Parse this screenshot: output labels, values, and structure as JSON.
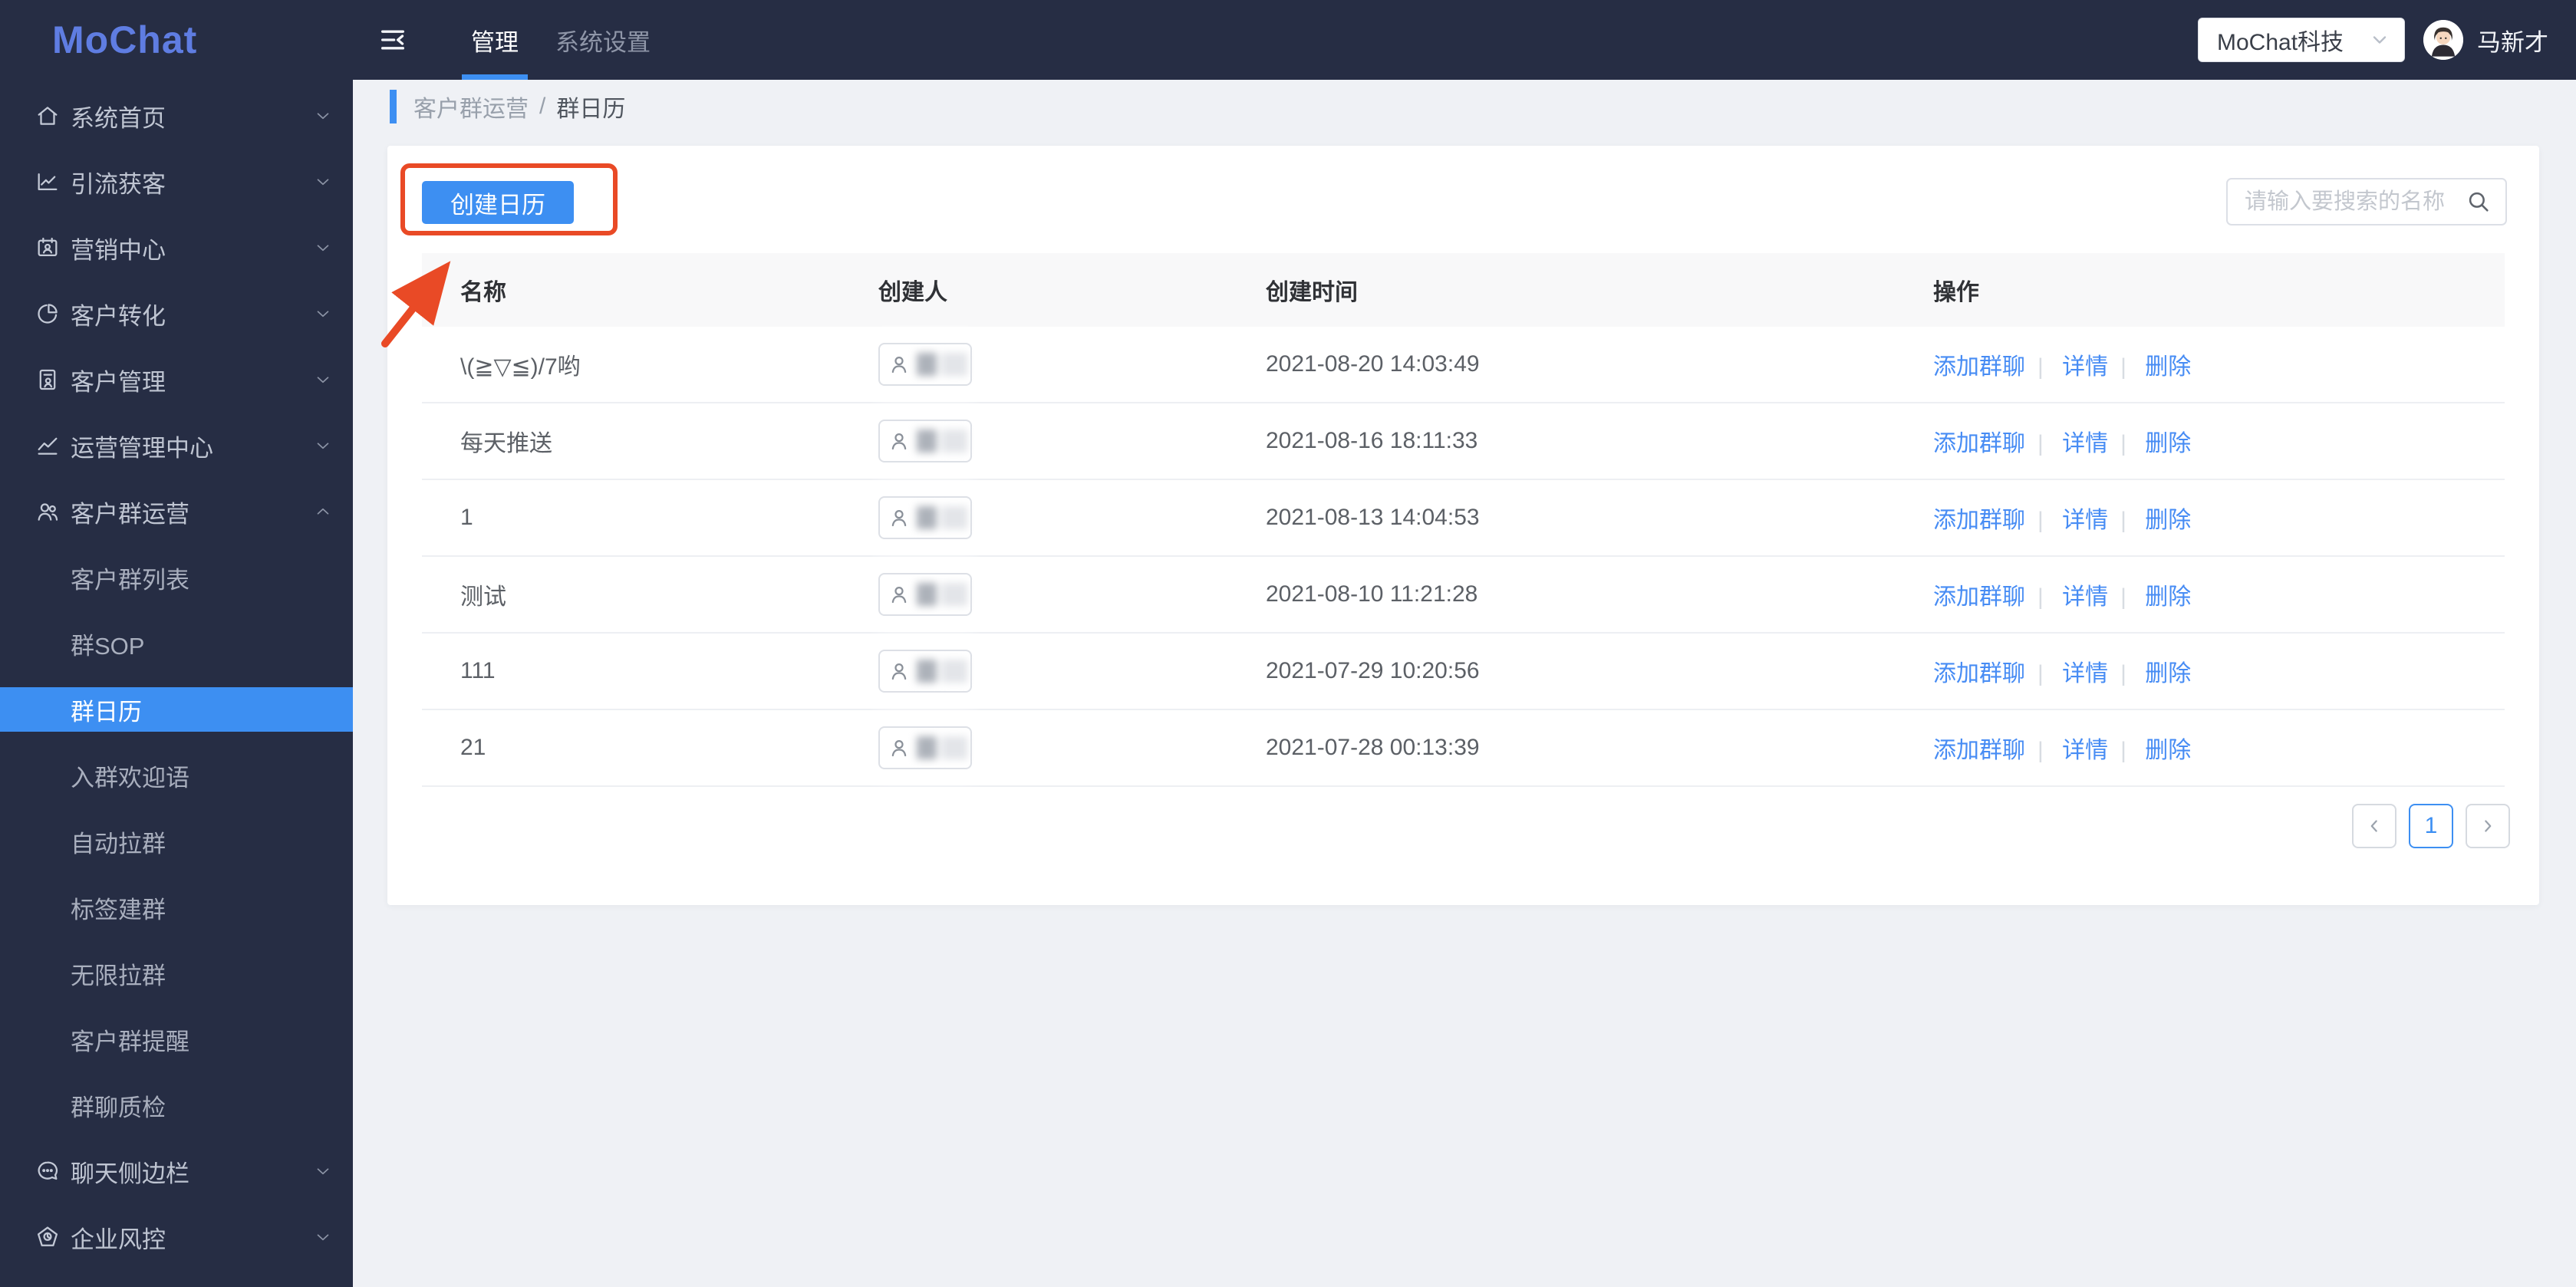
{
  "brand": {
    "logo": "MoChat"
  },
  "topbar": {
    "tabs": [
      {
        "label": "管理",
        "active": true
      },
      {
        "label": "系统设置",
        "active": false
      }
    ],
    "company_select": {
      "value": "MoChat科技"
    },
    "user_name": "马新才"
  },
  "sidebar": {
    "items": [
      {
        "label": "系统首页",
        "icon": "home-icon",
        "chevron": "down"
      },
      {
        "label": "引流获客",
        "icon": "chart-line-icon",
        "chevron": "down"
      },
      {
        "label": "营销中心",
        "icon": "marketing-icon",
        "chevron": "down"
      },
      {
        "label": "客户转化",
        "icon": "pie-chart-icon",
        "chevron": "down"
      },
      {
        "label": "客户管理",
        "icon": "customer-doc-icon",
        "chevron": "down"
      },
      {
        "label": "运营管理中心",
        "icon": "trend-icon",
        "chevron": "down"
      },
      {
        "label": "客户群运营",
        "icon": "group-icon",
        "chevron": "up",
        "children": [
          {
            "label": "客户群列表"
          },
          {
            "label": "群SOP"
          },
          {
            "label": "群日历",
            "active": true
          },
          {
            "label": "入群欢迎语"
          },
          {
            "label": "自动拉群"
          },
          {
            "label": "标签建群"
          },
          {
            "label": "无限拉群"
          },
          {
            "label": "客户群提醒"
          },
          {
            "label": "群聊质检"
          }
        ]
      },
      {
        "label": "聊天侧边栏",
        "icon": "chat-sidebar-icon",
        "chevron": "down"
      },
      {
        "label": "企业风控",
        "icon": "risk-shield-icon",
        "chevron": "down"
      }
    ]
  },
  "breadcrumb": {
    "items": [
      "客户群运营",
      "群日历"
    ],
    "separator": "/"
  },
  "toolbar": {
    "create_button": "创建日历",
    "search_placeholder": "请输入要搜索的名称"
  },
  "table": {
    "columns": [
      "名称",
      "创建人",
      "创建时间",
      "操作"
    ],
    "action_labels": [
      "添加群聊",
      "详情",
      "删除"
    ],
    "rows": [
      {
        "name": "\\(≧▽≦)/7哟",
        "created_at": "2021-08-20 14:03:49"
      },
      {
        "name": "每天推送",
        "created_at": "2021-08-16 18:11:33"
      },
      {
        "name": "1",
        "created_at": "2021-08-13 14:04:53"
      },
      {
        "name": "测试",
        "created_at": "2021-08-10 11:21:28"
      },
      {
        "name": "111",
        "created_at": "2021-07-29 10:20:56"
      },
      {
        "name": "21",
        "created_at": "2021-07-28 00:13:39"
      }
    ]
  },
  "pagination": {
    "current": "1"
  },
  "colors": {
    "accent_blue": "#3D8FF2",
    "link_blue": "#478CF4",
    "annotation_red": "#E94A26",
    "sidebar_bg": "#262D44",
    "logo_blue": "#5F7DE2",
    "page_bg": "#EFF1F5"
  }
}
